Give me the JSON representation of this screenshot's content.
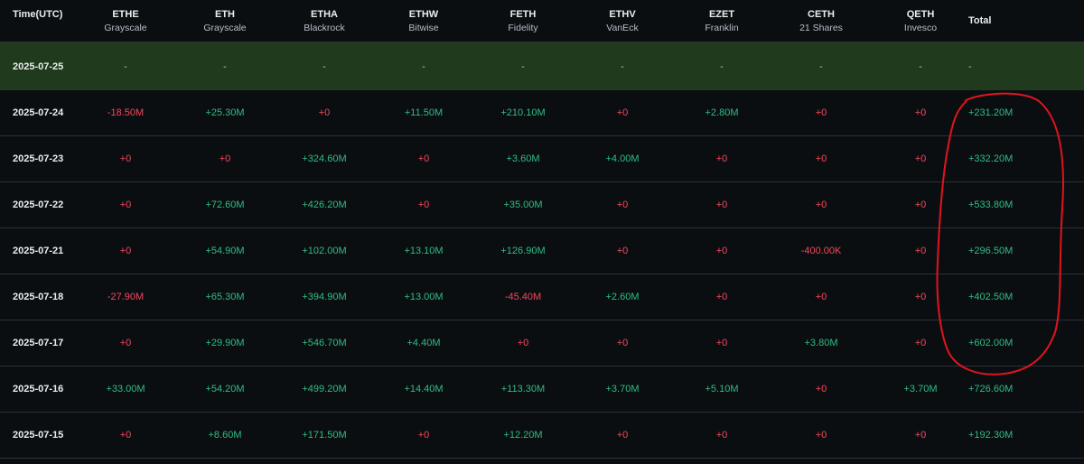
{
  "header": {
    "time_label": "Time(UTC)",
    "total_label": "Total",
    "columns": [
      {
        "ticker": "ETHE",
        "issuer": "Grayscale"
      },
      {
        "ticker": "ETH",
        "issuer": "Grayscale"
      },
      {
        "ticker": "ETHA",
        "issuer": "Blackrock"
      },
      {
        "ticker": "ETHW",
        "issuer": "Bitwise"
      },
      {
        "ticker": "FETH",
        "issuer": "Fidelity"
      },
      {
        "ticker": "ETHV",
        "issuer": "VanEck"
      },
      {
        "ticker": "EZET",
        "issuer": "Franklin"
      },
      {
        "ticker": "CETH",
        "issuer": "21 Shares"
      },
      {
        "ticker": "QETH",
        "issuer": "Invesco"
      }
    ]
  },
  "rows": [
    {
      "date": "2025-07-25",
      "values": [
        "-",
        "-",
        "-",
        "-",
        "-",
        "-",
        "-",
        "-",
        "-"
      ],
      "total": "-"
    },
    {
      "date": "2025-07-24",
      "values": [
        "-18.50M",
        "+25.30M",
        "+0",
        "+11.50M",
        "+210.10M",
        "+0",
        "+2.80M",
        "+0",
        "+0"
      ],
      "total": "+231.20M"
    },
    {
      "date": "2025-07-23",
      "values": [
        "+0",
        "+0",
        "+324.60M",
        "+0",
        "+3.60M",
        "+4.00M",
        "+0",
        "+0",
        "+0"
      ],
      "total": "+332.20M"
    },
    {
      "date": "2025-07-22",
      "values": [
        "+0",
        "+72.60M",
        "+426.20M",
        "+0",
        "+35.00M",
        "+0",
        "+0",
        "+0",
        "+0"
      ],
      "total": "+533.80M"
    },
    {
      "date": "2025-07-21",
      "values": [
        "+0",
        "+54.90M",
        "+102.00M",
        "+13.10M",
        "+126.90M",
        "+0",
        "+0",
        "-400.00K",
        "+0"
      ],
      "total": "+296.50M"
    },
    {
      "date": "2025-07-18",
      "values": [
        "-27.90M",
        "+65.30M",
        "+394.90M",
        "+13.00M",
        "-45.40M",
        "+2.60M",
        "+0",
        "+0",
        "+0"
      ],
      "total": "+402.50M"
    },
    {
      "date": "2025-07-17",
      "values": [
        "+0",
        "+29.90M",
        "+546.70M",
        "+4.40M",
        "+0",
        "+0",
        "+0",
        "+3.80M",
        "+0"
      ],
      "total": "+602.00M"
    },
    {
      "date": "2025-07-16",
      "values": [
        "+33.00M",
        "+54.20M",
        "+499.20M",
        "+14.40M",
        "+113.30M",
        "+3.70M",
        "+5.10M",
        "+0",
        "+3.70M"
      ],
      "total": "+726.60M"
    },
    {
      "date": "2025-07-15",
      "values": [
        "+0",
        "+8.60M",
        "+171.50M",
        "+0",
        "+12.20M",
        "+0",
        "+0",
        "+0",
        "+0"
      ],
      "total": "+192.30M"
    }
  ],
  "colors": {
    "background": "#0b0e11",
    "positive": "#2ebd85",
    "negative": "#f6465d",
    "highlight_row": "#1f3a1c",
    "annotation": "#e0141e"
  }
}
